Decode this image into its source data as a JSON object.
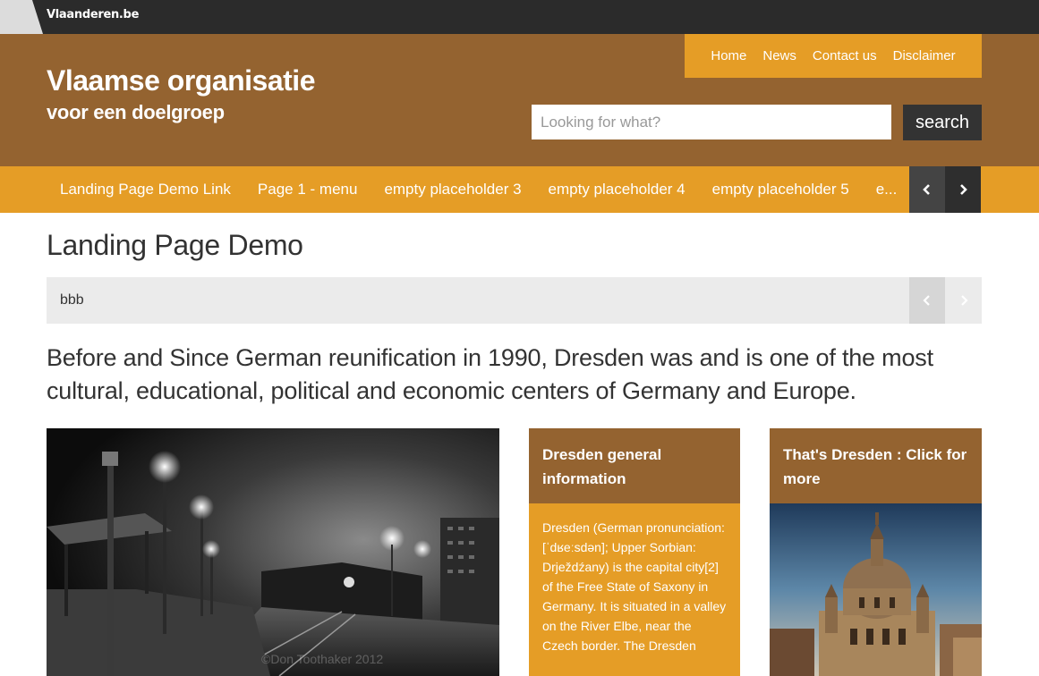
{
  "topbar": {
    "brand": "Vlaanderen.be"
  },
  "header": {
    "title": "Vlaamse organisatie",
    "subtitle": "voor een doelgroep",
    "utility_nav": [
      "Home",
      "News",
      "Contact us",
      "Disclaimer"
    ],
    "search": {
      "placeholder": "Looking for what?",
      "button": "search"
    }
  },
  "main_nav": {
    "items": [
      "Landing Page Demo Link",
      "Page 1 - menu",
      "empty placeholder 3",
      "empty placeholder 4",
      "empty placeholder 5",
      "e..."
    ]
  },
  "content": {
    "page_title": "Landing Page Demo",
    "breadcrumb": "bbb",
    "lead": "Before and Since German reunification in 1990, Dresden was and is one of the most cultural, educational, political and economic centers of Germany and Europe.",
    "photo_caption": "©Don Toothaker 2012"
  },
  "cards": [
    {
      "title": "Dresden general information",
      "body": "Dresden (German pronunciation: [ˈdʁeːsdən]; Upper Sorbian: Drježdźany) is the capital city[2] of the Free State of Saxony in Germany. It is situated in a valley on the River Elbe, near the Czech border. The Dresden"
    },
    {
      "title": "That's Dresden : Click for more"
    }
  ],
  "colors": {
    "brown": "#946330",
    "orange": "#e59d26",
    "dark": "#2b2b2b"
  }
}
